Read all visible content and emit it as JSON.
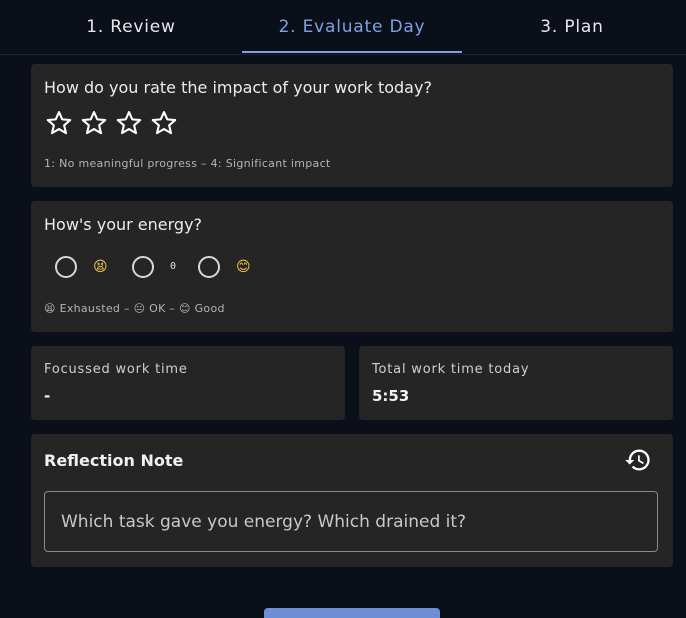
{
  "tabs": [
    {
      "label": "1. Review"
    },
    {
      "label": "2. Evaluate Day"
    },
    {
      "label": "3. Plan"
    }
  ],
  "active_tab": 1,
  "impact": {
    "question": "How do you rate the impact of your work today?",
    "star_count": 4,
    "selected": 0,
    "hint": "1: No meaningful progress – 4: Significant impact"
  },
  "energy": {
    "question": "How's your energy?",
    "options": [
      {
        "emoji": "😫"
      },
      {
        "emoji": "0"
      },
      {
        "emoji": "😊"
      }
    ],
    "selected": null,
    "hint": "😫 Exhausted – 😐 OK – 😊 Good"
  },
  "stats": {
    "focused_label": "Focussed work time",
    "focused_value": "-",
    "total_label": "Total work time today",
    "total_value": "5:53"
  },
  "reflection": {
    "title": "Reflection Note",
    "placeholder": "Which task gave you energy? Which drained it?",
    "history_icon": "history-icon"
  },
  "colors": {
    "accent": "#7ea2e0",
    "background": "#0a0f1a",
    "card": "#252525"
  }
}
